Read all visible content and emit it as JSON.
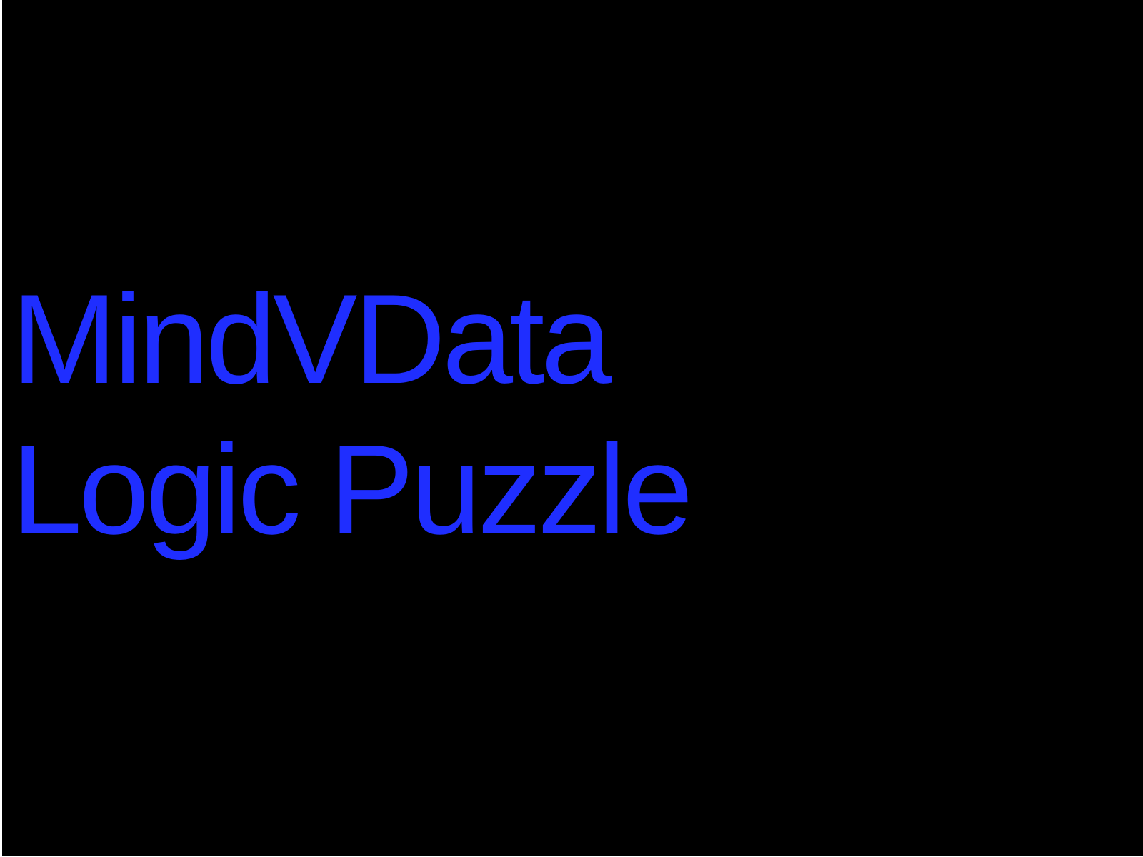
{
  "screen": {
    "background_color": "#000000",
    "text_color": "#1f2eff",
    "title_lines": [
      "MindVData",
      "Logic Puzzle"
    ]
  }
}
